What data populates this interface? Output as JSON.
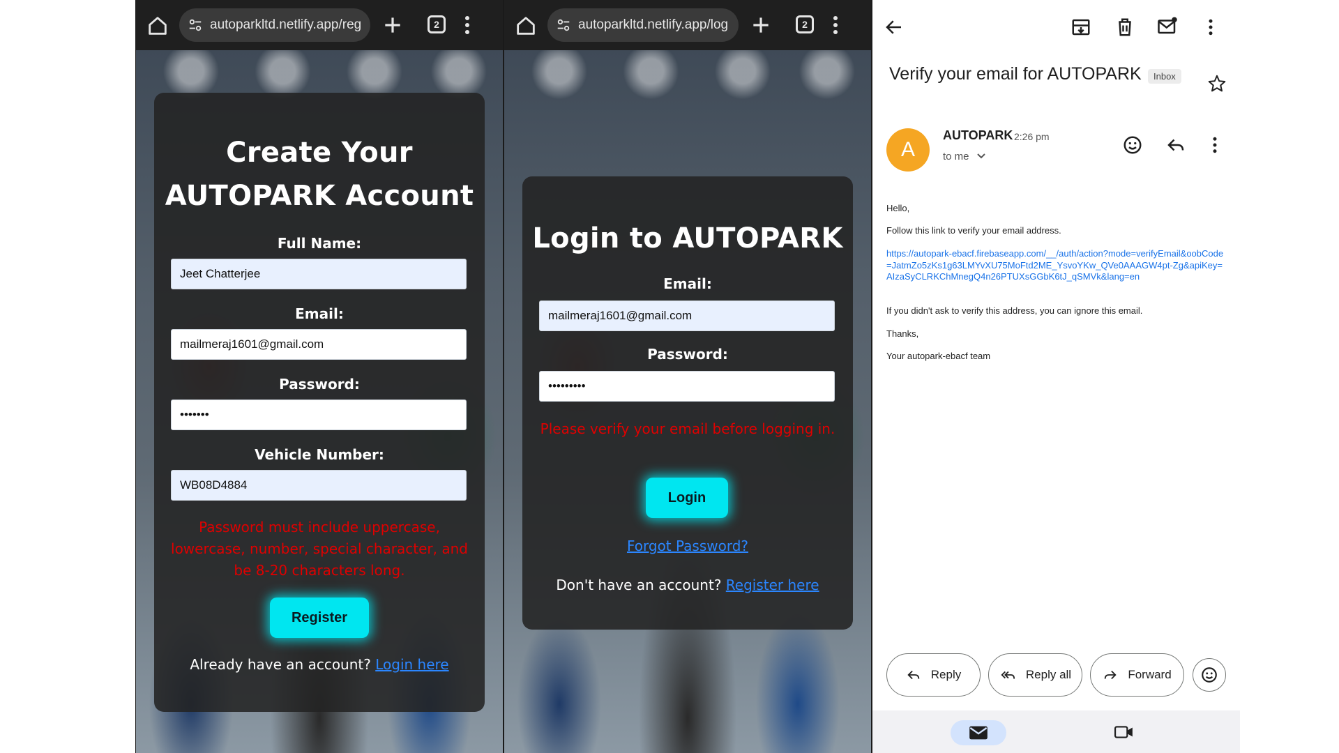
{
  "panels": {
    "register": {
      "url": "autoparkltd.netlify.app/reg",
      "tab_count": "2",
      "title_line1": "Create Your",
      "title_line2": "AUTOPARK Account",
      "full_name_label": "Full Name:",
      "full_name_value": "Jeet Chatterjee",
      "email_label": "Email:",
      "email_value": "mailmeraj1601@gmail.com",
      "password_label": "Password:",
      "password_value": "•••••••",
      "vehicle_label": "Vehicle Number:",
      "vehicle_value": "WB08D4884",
      "error_text": "Password must include uppercase, lowercase, number, special character, and be 8-20 characters long.",
      "register_button": "Register",
      "footer_text": "Already have an account?",
      "footer_link": "Login here"
    },
    "login": {
      "url": "autoparkltd.netlify.app/log",
      "tab_count": "2",
      "title": "Login to AUTOPARK",
      "email_label": "Email:",
      "email_value": "mailmeraj1601@gmail.com",
      "password_label": "Password:",
      "password_value": "•••••••••",
      "error_text": "Please verify your email before logging in.",
      "login_button": "Login",
      "forgot_link": "Forgot Password?",
      "footer_text": "Don't have an account?",
      "footer_link": "Register here"
    },
    "gmail": {
      "subject": "Verify your email for AUTOPARK",
      "folder_chip": "Inbox",
      "avatar_letter": "A",
      "sender": "AUTOPARK",
      "time": "2:26 pm",
      "recipient": "to me",
      "greeting": "Hello,",
      "line1": "Follow this link to verify your email address.",
      "verify_url": "https://autopark-ebacf.firebaseapp.com/__/auth/action?mode=verifyEmail&oobCode=JatmZo5zKs1g63LMYvXU75MoFtd2ME_YsvoYKw_QVe0AAAGW4pt-Zg&apiKey=AIzaSyCLRKChMnegQ4n26PTUXsGGbK6tJ_qSMVk&lang=en",
      "line2": "If you didn't ask to verify this address, you can ignore this email.",
      "thanks": "Thanks,",
      "signature": "Your autopark-ebacf team",
      "reply_button": "Reply",
      "reply_all_button": "Reply all",
      "forward_button": "Forward"
    }
  },
  "colors": {
    "accent_cyan": "#00e6f0",
    "error_red": "#e00000",
    "link_blue": "#2b86ff",
    "avatar_orange": "#f5a623"
  },
  "icons": [
    "home-icon",
    "site-info-icon",
    "new-tab-icon",
    "tab-switcher-icon",
    "menu-icon",
    "back-arrow-icon",
    "archive-icon",
    "delete-icon",
    "mark-unread-icon",
    "star-icon",
    "emoji-icon",
    "reply-icon",
    "reply-all-icon",
    "forward-icon",
    "mail-icon",
    "video-icon"
  ]
}
